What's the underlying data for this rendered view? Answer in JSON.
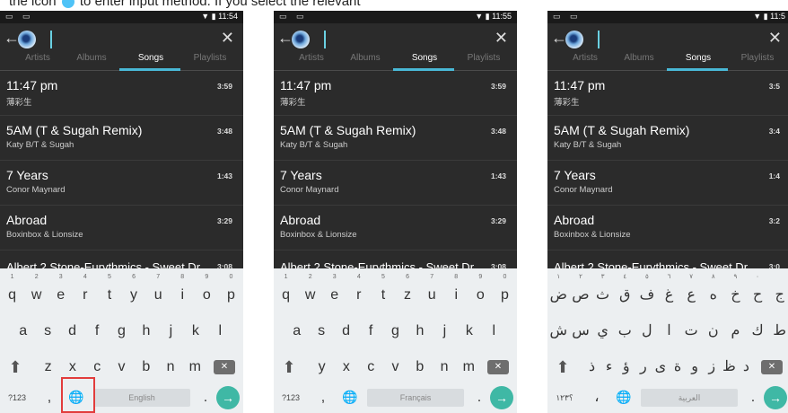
{
  "caption": {
    "text_before": "the icon ",
    "text_after": " to enter input method. If you select the relevant"
  },
  "panels": [
    {
      "status_time": "11:54",
      "tabs": [
        "Artists",
        "Albums",
        "Songs",
        "Playlists"
      ],
      "active_tab": "Songs",
      "songs": [
        {
          "title": "11:47 pm",
          "artist": "薄彩生",
          "duration": "3:59"
        },
        {
          "title": "5AM (T & Sugah Remix)",
          "artist": "Katy B/T & Sugah",
          "duration": "3:48"
        },
        {
          "title": "7 Years",
          "artist": "Conor Maynard",
          "duration": "1:43"
        },
        {
          "title": "Abroad",
          "artist": "Boxinbox & Lionsize",
          "duration": "3:29"
        }
      ],
      "partial_song": {
        "title": "Albert 2 Stone-Eurythmics - Sweet Dr...",
        "duration": "3:08"
      },
      "keyboard": {
        "row1": [
          "q",
          "w",
          "e",
          "r",
          "t",
          "y",
          "u",
          "i",
          "o",
          "p"
        ],
        "row2": [
          "a",
          "s",
          "d",
          "f",
          "g",
          "h",
          "j",
          "k",
          "l"
        ],
        "row3": [
          "z",
          "x",
          "c",
          "v",
          "b",
          "n",
          "m"
        ],
        "numbers": [
          "1",
          "2",
          "3",
          "4",
          "5",
          "6",
          "7",
          "8",
          "9",
          "0"
        ],
        "symbols_key": "?123",
        "comma": ",",
        "period": ".",
        "space_label": "English"
      }
    },
    {
      "status_time": "11:55",
      "tabs": [
        "Artists",
        "Albums",
        "Songs",
        "Playlists"
      ],
      "active_tab": "Songs",
      "songs": [
        {
          "title": "11:47 pm",
          "artist": "薄彩生",
          "duration": "3:59"
        },
        {
          "title": "5AM (T & Sugah Remix)",
          "artist": "Katy B/T & Sugah",
          "duration": "3:48"
        },
        {
          "title": "7 Years",
          "artist": "Conor Maynard",
          "duration": "1:43"
        },
        {
          "title": "Abroad",
          "artist": "Boxinbox & Lionsize",
          "duration": "3:29"
        }
      ],
      "partial_song": {
        "title": "Albert 2 Stone-Eurythmics - Sweet Dr...",
        "duration": "3:08"
      },
      "keyboard": {
        "row1": [
          "q",
          "w",
          "e",
          "r",
          "t",
          "z",
          "u",
          "i",
          "o",
          "p"
        ],
        "row2": [
          "a",
          "s",
          "d",
          "f",
          "g",
          "h",
          "j",
          "k",
          "l"
        ],
        "row3": [
          "y",
          "x",
          "c",
          "v",
          "b",
          "n",
          "m"
        ],
        "numbers": [
          "1",
          "2",
          "3",
          "4",
          "5",
          "6",
          "7",
          "8",
          "9",
          "0"
        ],
        "symbols_key": "?123",
        "comma": ",",
        "period": ".",
        "space_label": "Français"
      }
    },
    {
      "status_time": "11:5",
      "tabs": [
        "Artists",
        "Albums",
        "Songs",
        "Playlists"
      ],
      "active_tab": "Songs",
      "songs": [
        {
          "title": "11:47 pm",
          "artist": "薄彩生",
          "duration": "3:5"
        },
        {
          "title": "5AM (T & Sugah Remix)",
          "artist": "Katy B/T & Sugah",
          "duration": "3:4"
        },
        {
          "title": "7 Years",
          "artist": "Conor Maynard",
          "duration": "1:4"
        },
        {
          "title": "Abroad",
          "artist": "Boxinbox & Lionsize",
          "duration": "3:2"
        }
      ],
      "partial_song": {
        "title": "Albert 2 Stone-Eurythmics - Sweet Dr...",
        "duration": "3:0"
      },
      "keyboard": {
        "row1": [
          "ض",
          "ص",
          "ث",
          "ق",
          "ف",
          "غ",
          "ع",
          "ه",
          "خ",
          "ح",
          "ج"
        ],
        "row2": [
          "ش",
          "س",
          "ي",
          "ب",
          "ل",
          "ا",
          "ت",
          "ن",
          "م",
          "ك",
          "ط"
        ],
        "row3": [
          "ذ",
          "ء",
          "ؤ",
          "ر",
          "ى",
          "ة",
          "و",
          "ز",
          "ظ",
          "د"
        ],
        "numbers": [
          "١",
          "٢",
          "٣",
          "٤",
          "٥",
          "٦",
          "٧",
          "٨",
          "٩",
          "٠"
        ],
        "symbols_key": "؟١٢٣",
        "comma": "،",
        "period": ".",
        "space_label": "العربية"
      }
    }
  ]
}
